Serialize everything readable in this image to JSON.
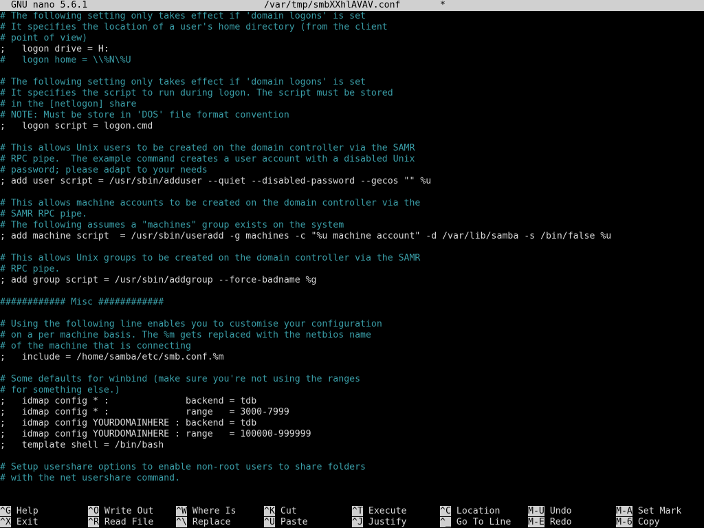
{
  "titlebar": {
    "app": "GNU nano 5.6.1",
    "filename": "/var/tmp/smbXXhlAVAV.conf",
    "modified_marker": "*"
  },
  "editor": {
    "lines": [
      {
        "text": "# The following setting only takes effect if 'domain logons' is set",
        "kind": "comment"
      },
      {
        "text": "# It specifies the location of a user's home directory (from the client",
        "kind": "comment"
      },
      {
        "text": "# point of view)",
        "kind": "comment"
      },
      {
        "text": ";   logon drive = H:",
        "kind": "plain"
      },
      {
        "text": "#   logon home = \\\\%N\\%U",
        "kind": "comment"
      },
      {
        "text": "",
        "kind": "plain"
      },
      {
        "text": "# The following setting only takes effect if 'domain logons' is set",
        "kind": "comment"
      },
      {
        "text": "# It specifies the script to run during logon. The script must be stored",
        "kind": "comment"
      },
      {
        "text": "# in the [netlogon] share",
        "kind": "comment"
      },
      {
        "text": "# NOTE: Must be store in 'DOS' file format convention",
        "kind": "comment"
      },
      {
        "text": ";   logon script = logon.cmd",
        "kind": "plain"
      },
      {
        "text": "",
        "kind": "plain"
      },
      {
        "text": "# This allows Unix users to be created on the domain controller via the SAMR",
        "kind": "comment"
      },
      {
        "text": "# RPC pipe.  The example command creates a user account with a disabled Unix",
        "kind": "comment"
      },
      {
        "text": "# password; please adapt to your needs",
        "kind": "comment"
      },
      {
        "text": "; add user script = /usr/sbin/adduser --quiet --disabled-password --gecos \"\" %u",
        "kind": "plain"
      },
      {
        "text": "",
        "kind": "plain"
      },
      {
        "text": "# This allows machine accounts to be created on the domain controller via the",
        "kind": "comment"
      },
      {
        "text": "# SAMR RPC pipe.",
        "kind": "comment"
      },
      {
        "text": "# The following assumes a \"machines\" group exists on the system",
        "kind": "comment"
      },
      {
        "text": "; add machine script  = /usr/sbin/useradd -g machines -c \"%u machine account\" -d /var/lib/samba -s /bin/false %u",
        "kind": "plain"
      },
      {
        "text": "",
        "kind": "plain"
      },
      {
        "text": "# This allows Unix groups to be created on the domain controller via the SAMR",
        "kind": "comment"
      },
      {
        "text": "# RPC pipe.",
        "kind": "comment"
      },
      {
        "text": "; add group script = /usr/sbin/addgroup --force-badname %g",
        "kind": "plain"
      },
      {
        "text": "",
        "kind": "plain"
      },
      {
        "text": "############ Misc ############",
        "kind": "comment"
      },
      {
        "text": "",
        "kind": "plain"
      },
      {
        "text": "# Using the following line enables you to customise your configuration",
        "kind": "comment"
      },
      {
        "text": "# on a per machine basis. The %m gets replaced with the netbios name",
        "kind": "comment"
      },
      {
        "text": "# of the machine that is connecting",
        "kind": "comment"
      },
      {
        "text": ";   include = /home/samba/etc/smb.conf.%m",
        "kind": "plain"
      },
      {
        "text": "",
        "kind": "plain"
      },
      {
        "text": "# Some defaults for winbind (make sure you're not using the ranges",
        "kind": "comment"
      },
      {
        "text": "# for something else.)",
        "kind": "comment"
      },
      {
        "text": ";   idmap config * :              backend = tdb",
        "kind": "plain"
      },
      {
        "text": ";   idmap config * :              range   = 3000-7999",
        "kind": "plain"
      },
      {
        "text": ";   idmap config YOURDOMAINHERE : backend = tdb",
        "kind": "plain"
      },
      {
        "text": ";   idmap config YOURDOMAINHERE : range   = 100000-999999",
        "kind": "plain"
      },
      {
        "text": ";   template shell = /bin/bash",
        "kind": "plain"
      },
      {
        "text": "",
        "kind": "plain"
      },
      {
        "text": "# Setup usershare options to enable non-root users to share folders",
        "kind": "comment"
      },
      {
        "text": "# with the net usershare command.",
        "kind": "comment"
      }
    ]
  },
  "shortcuts": {
    "row1": [
      {
        "key": "^G",
        "label": "Help"
      },
      {
        "key": "^O",
        "label": "Write Out"
      },
      {
        "key": "^W",
        "label": "Where Is"
      },
      {
        "key": "^K",
        "label": "Cut"
      },
      {
        "key": "^T",
        "label": "Execute"
      },
      {
        "key": "^C",
        "label": "Location"
      },
      {
        "key": "M-U",
        "label": "Undo"
      },
      {
        "key": "M-A",
        "label": "Set Mark"
      }
    ],
    "row2": [
      {
        "key": "^X",
        "label": "Exit"
      },
      {
        "key": "^R",
        "label": "Read File"
      },
      {
        "key": "^\\",
        "label": "Replace"
      },
      {
        "key": "^U",
        "label": "Paste"
      },
      {
        "key": "^J",
        "label": "Justify"
      },
      {
        "key": "^_",
        "label": "Go To Line"
      },
      {
        "key": "M-E",
        "label": "Redo"
      },
      {
        "key": "M-6",
        "label": "Copy"
      }
    ]
  },
  "colors": {
    "background": "#000000",
    "comment": "#3a9ea8",
    "text": "#d8d8d8",
    "bar": "#d0d0d0"
  }
}
